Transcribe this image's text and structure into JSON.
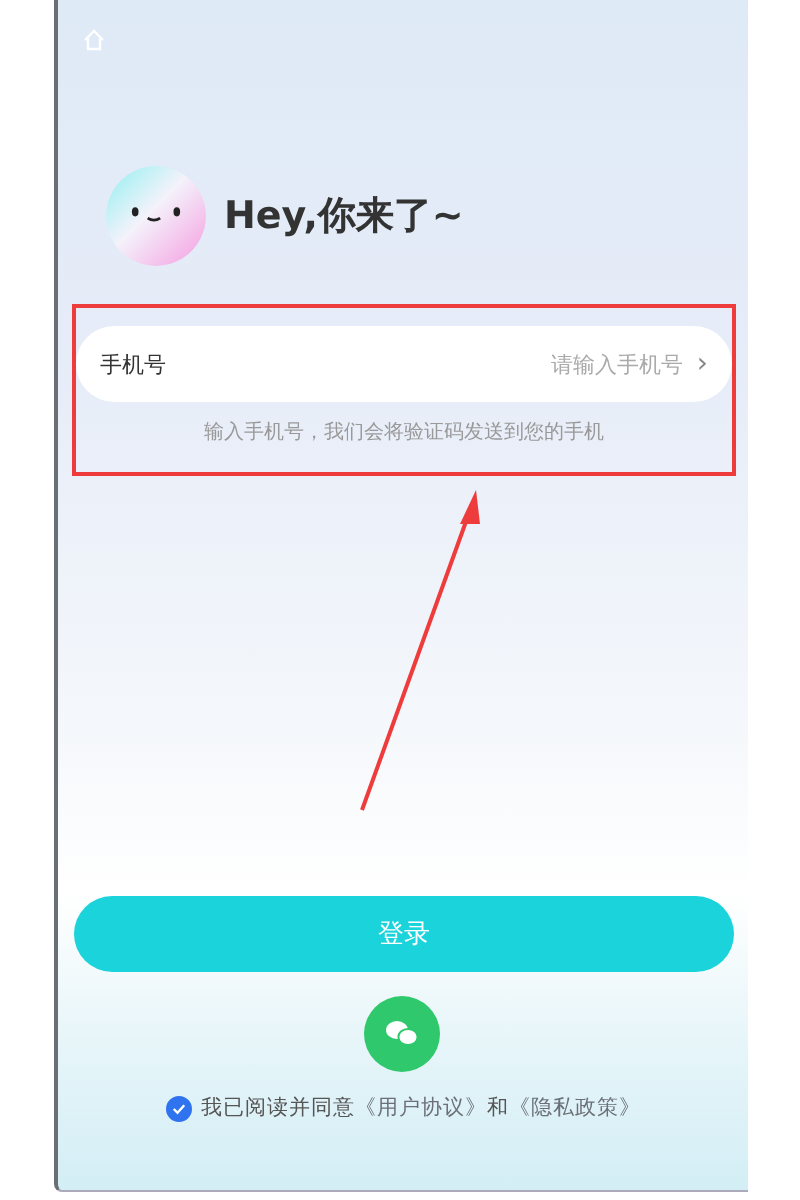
{
  "greeting": "Hey,你来了~",
  "phone_field": {
    "label": "手机号",
    "placeholder": "请输入手机号",
    "chevron": "›"
  },
  "hint": "输入手机号，我们会将验证码发送到您的手机",
  "login_button": "登录",
  "agreement": {
    "checked": true,
    "parts": [
      {
        "kind": "text",
        "text": "我已阅读并同意"
      },
      {
        "kind": "link",
        "text": "《用户协议》"
      },
      {
        "kind": "text",
        "text": "和"
      },
      {
        "kind": "link",
        "text": "《隐私政策》"
      }
    ]
  }
}
